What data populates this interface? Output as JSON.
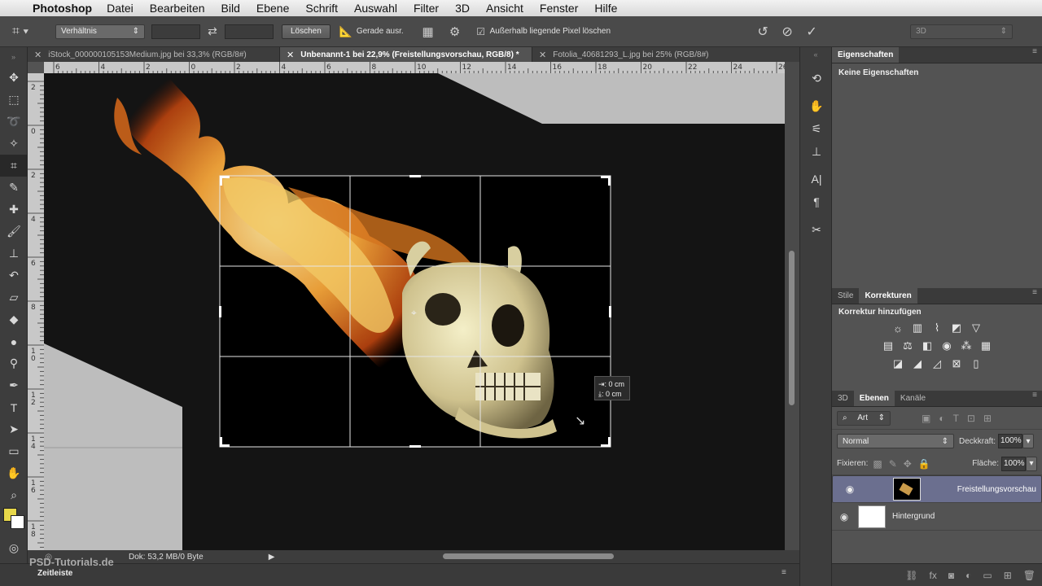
{
  "menubar": {
    "app_name": "Photoshop",
    "items": [
      "Datei",
      "Bearbeiten",
      "Bild",
      "Ebene",
      "Schrift",
      "Auswahl",
      "Filter",
      "3D",
      "Ansicht",
      "Fenster",
      "Hilfe"
    ]
  },
  "options": {
    "ratio_select": "Verhältnis",
    "clear_button": "Löschen",
    "straighten_label": "Gerade ausr.",
    "delete_pixels_label": "Außerhalb liegende Pixel löschen",
    "mode_select": "3D"
  },
  "tabs": [
    {
      "label": "iStock_000000105153Medium.jpg bei 33,3% (RGB/8#)",
      "active": false
    },
    {
      "label": "Unbenannt-1 bei 22,9% (Freistellungsvorschau, RGB/8) *",
      "active": true
    },
    {
      "label": "Fotolia_40681293_L.jpg bei 25% (RGB/8#)",
      "active": false
    }
  ],
  "ruler_top": [
    "6",
    "4",
    "2",
    "0",
    "2",
    "4",
    "6",
    "8",
    "10",
    "12",
    "14",
    "16",
    "18",
    "20",
    "22",
    "24",
    "26"
  ],
  "ruler_left": [
    "2",
    "0",
    "2",
    "4",
    "6",
    "8",
    "1\n0",
    "1\n2",
    "1\n4",
    "1\n6",
    "1\n8"
  ],
  "crop_tooltip": {
    "w": ": 0 cm",
    "h": ": 0 cm"
  },
  "status": {
    "doc_info": "Dok: 53,2 MB/0 Byte"
  },
  "timeline": {
    "label": "Zeitleiste",
    "watermark": "PSD-Tutorials.de"
  },
  "properties": {
    "tab": "Eigenschaften",
    "empty": "Keine Eigenschaften"
  },
  "adjustments": {
    "tab_styles": "Stile",
    "tab_corrections": "Korrekturen",
    "add_label": "Korrektur hinzufügen"
  },
  "layers": {
    "tab_3d": "3D",
    "tab_layers": "Ebenen",
    "tab_channels": "Kanäle",
    "filter_kind": "Art",
    "blend_mode": "Normal",
    "opacity_label": "Deckkraft:",
    "opacity": "100%",
    "lock_label": "Fixieren:",
    "fill_label": "Fläche:",
    "fill": "100%",
    "items": [
      {
        "name": "Freistellungsvorschau",
        "selected": true
      },
      {
        "name": "Hintergrund",
        "selected": false
      }
    ]
  },
  "colors": {
    "foreground": "#e8d84a",
    "background": "#ffffff",
    "selection": "#6b6f8f"
  }
}
